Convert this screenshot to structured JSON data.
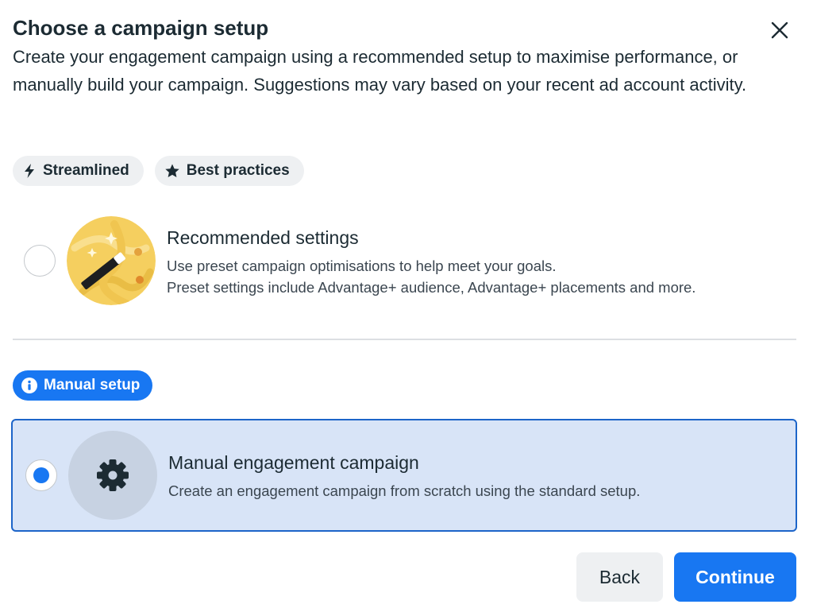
{
  "dialog": {
    "title": "Choose a campaign setup",
    "description": "Create your engagement campaign using a recommended setup to maximise performance, or manually build your campaign. Suggestions may vary based on your recent ad account activity."
  },
  "tags": [
    {
      "label": "Streamlined",
      "icon": "lightning-bolt-icon"
    },
    {
      "label": "Best practices",
      "icon": "star-icon"
    }
  ],
  "options": {
    "recommended": {
      "title": "Recommended settings",
      "line1": "Use preset campaign optimisations to help meet your goals.",
      "line2": "Preset settings include Advantage+ audience, Advantage+ placements and more.",
      "selected": false,
      "icon": "magic-wand-icon"
    },
    "manual": {
      "badge": "Manual setup",
      "badge_icon": "info-icon",
      "title": "Manual engagement campaign",
      "line1": "Create an engagement campaign from scratch using the standard setup.",
      "selected": true,
      "icon": "gear-icon"
    }
  },
  "buttons": {
    "back": "Back",
    "continue": "Continue"
  },
  "colors": {
    "accent": "#1877f2",
    "selected_bg": "#d8e4f7",
    "selected_border": "#1d65c9",
    "illustration_yellow": "#f5cf5f"
  }
}
